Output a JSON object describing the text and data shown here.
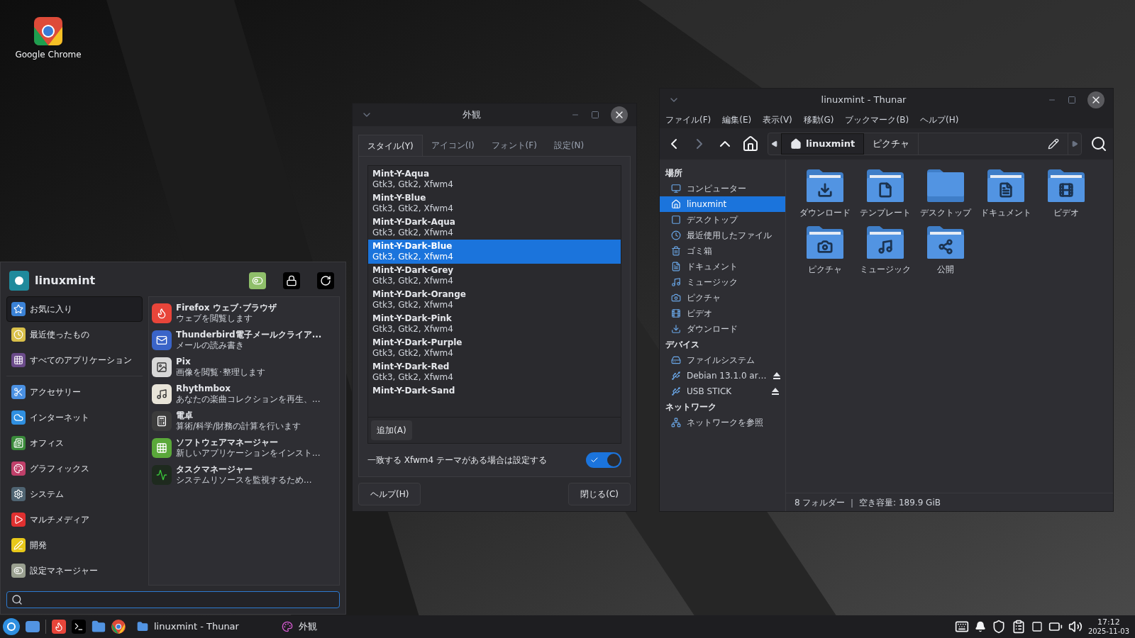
{
  "desktop_icons": [
    {
      "label": "Google Chrome"
    }
  ],
  "app_menu": {
    "user": "linuxmint",
    "categories": [
      {
        "label": "お気に入り",
        "selected": true
      },
      {
        "label": "最近使ったもの",
        "selected": false
      },
      {
        "label": "すべてのアプリケーション",
        "selected": false
      },
      {
        "label": "アクセサリー",
        "selected": false
      },
      {
        "label": "インターネット",
        "selected": false
      },
      {
        "label": "オフィス",
        "selected": false
      },
      {
        "label": "グラフィックス",
        "selected": false
      },
      {
        "label": "システム",
        "selected": false
      },
      {
        "label": "マルチメディア",
        "selected": false
      },
      {
        "label": "開発",
        "selected": false
      },
      {
        "label": "設定マネージャー",
        "selected": false
      }
    ],
    "favorites": [
      {
        "name": "Firefox ウェブ･ブラウザ",
        "description": "ウェブを閲覧します"
      },
      {
        "name": "Thunderbird電子メールクライア...",
        "description": "メールの読み書き"
      },
      {
        "name": "Pix",
        "description": "画像を閲覧･整理します"
      },
      {
        "name": "Rhythmbox",
        "description": "あなたの楽曲コレクションを再生、..."
      },
      {
        "name": "電卓",
        "description": "算術/科学/財務の計算を行います"
      },
      {
        "name": "ソフトウェアマネージャー",
        "description": "新しいアプリケーションをインスト..."
      },
      {
        "name": "タスクマネージャー",
        "description": "システムリソースを監視するため..."
      }
    ]
  },
  "appearance_dialog": {
    "title": "外観",
    "tabs": [
      {
        "label": "スタイル(Y)",
        "selected": true
      },
      {
        "label": "アイコン(I)",
        "selected": false
      },
      {
        "label": "フォント(F)",
        "selected": false
      },
      {
        "label": "設定(N)",
        "selected": false
      }
    ],
    "themes": [
      {
        "name": "Mint-Y-Aqua",
        "detail": "Gtk3, Gtk2, Xfwm4",
        "selected": false
      },
      {
        "name": "Mint-Y-Blue",
        "detail": "Gtk3, Gtk2, Xfwm4",
        "selected": false
      },
      {
        "name": "Mint-Y-Dark-Aqua",
        "detail": "Gtk3, Gtk2, Xfwm4",
        "selected": false
      },
      {
        "name": "Mint-Y-Dark-Blue",
        "detail": "Gtk3, Gtk2, Xfwm4",
        "selected": true
      },
      {
        "name": "Mint-Y-Dark-Grey",
        "detail": "Gtk3, Gtk2, Xfwm4",
        "selected": false
      },
      {
        "name": "Mint-Y-Dark-Orange",
        "detail": "Gtk3, Gtk2, Xfwm4",
        "selected": false
      },
      {
        "name": "Mint-Y-Dark-Pink",
        "detail": "Gtk3, Gtk2, Xfwm4",
        "selected": false
      },
      {
        "name": "Mint-Y-Dark-Purple",
        "detail": "Gtk3, Gtk2, Xfwm4",
        "selected": false
      },
      {
        "name": "Mint-Y-Dark-Red",
        "detail": "Gtk3, Gtk2, Xfwm4",
        "selected": false
      },
      {
        "name": "Mint-Y-Dark-Sand",
        "selected": false
      }
    ],
    "add_button": "追加(A)",
    "toggle": {
      "label": "一致する Xfwm4 テーマがある場合は設定する",
      "on": true
    },
    "help_button": "ヘルプ(H)",
    "close_button": "閉じる(C)"
  },
  "file_manager": {
    "title": "linuxmint - Thunar",
    "menu": [
      "ファイル(F)",
      "編集(E)",
      "表示(V)",
      "移動(G)",
      "ブックマーク(B)",
      "ヘルプ(H)"
    ],
    "path": [
      {
        "label": "linuxmint",
        "selected": true
      },
      {
        "label": "ピクチャ",
        "selected": false
      }
    ],
    "sidebar": [
      {
        "heading": "場所",
        "items": [
          {
            "label": "コンピューター",
            "selected": false
          },
          {
            "label": "linuxmint",
            "selected": true
          },
          {
            "label": "デスクトップ",
            "selected": false
          },
          {
            "label": "最近使用したファイル",
            "selected": false
          },
          {
            "label": "ゴミ箱",
            "selected": false
          },
          {
            "label": "ドキュメント",
            "selected": false
          },
          {
            "label": "ミュージック",
            "selected": false
          },
          {
            "label": "ピクチャ",
            "selected": false
          },
          {
            "label": "ビデオ",
            "selected": false
          },
          {
            "label": "ダウンロード",
            "selected": false
          }
        ]
      },
      {
        "heading": "デバイス",
        "items": [
          {
            "label": "ファイルシステム",
            "selected": false,
            "ejectable": false
          },
          {
            "label": "Debian 13.1.0 ar…",
            "selected": false,
            "ejectable": true
          },
          {
            "label": "USB STICK",
            "selected": false,
            "ejectable": true
          }
        ]
      },
      {
        "heading": "ネットワーク",
        "items": [
          {
            "label": "ネットワークを参照",
            "selected": false
          }
        ]
      }
    ],
    "folders": [
      {
        "label": "ダウンロード"
      },
      {
        "label": "テンプレート"
      },
      {
        "label": "デスクトップ"
      },
      {
        "label": "ドキュメント"
      },
      {
        "label": "ビデオ"
      },
      {
        "label": "ピクチャ"
      },
      {
        "label": "ミュージック"
      },
      {
        "label": "公開"
      }
    ],
    "status": "8 フォルダー ｜ 空き容量: 189.9 GiB"
  },
  "taskbar": {
    "tasks": [
      {
        "label": "linuxmint - Thunar"
      },
      {
        "label": "外観"
      }
    ],
    "time": "17:12",
    "date": "2025-11-03"
  }
}
